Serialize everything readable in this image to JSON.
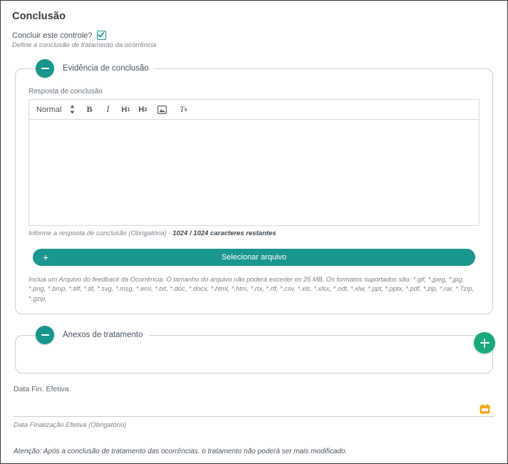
{
  "page": {
    "title": "Conclusão"
  },
  "conclude_control": {
    "label": "Concluir este controle?",
    "checked": true,
    "hint": "Define a conclusão de tratamento da ocorrência"
  },
  "evidence_group": {
    "legend": "Evidência de conclusão",
    "collapse_icon": "minus-icon",
    "answer_label": "Resposta de conclusão",
    "toolbar": {
      "format_select": "Normal",
      "caret_icon": "updown-caret-icon",
      "bold": "B",
      "italic": "I",
      "h1": "H1",
      "h1_main": "H",
      "h1_sub": "1",
      "h2_main": "H",
      "h2_sub": "2",
      "image_icon": "image-icon",
      "clear_main": "T",
      "clear_sub": "x"
    },
    "editor_value": "",
    "char_hint_prefix": "Informe a resposta de conclusão (Obrigatória) - ",
    "char_hint_counter": "1024 / 1024 caracteres restantes",
    "file_button": {
      "label": "Selecionar arquivo",
      "plus_icon": "plus-icon"
    },
    "formats_hint": "Inclua um Arquivo do feedback da Ocorrência. O tamanho do arquivo não poderá exceder os 25 MB. Os formatos suportados são: *.gif, *.jpeg, *.jpg, *.png, *.bmp, *.tiff, *.tif, *.svg, *.msg, *.eml, *.txt, *.doc, *.docx, *.html, *.htm, *.rtx, *.rtf, *.csv, *.xls, *.xlsx, *.odt, *.xlw, *.ppt, *.pptx, *.pdf, *.zip, *.rar, *.7zip, *.gzip."
  },
  "attachments_group": {
    "legend": "Anexos de tratamento",
    "collapse_icon": "minus-icon",
    "add_icon": "plus-icon"
  },
  "date_field": {
    "label": "Data Fin. Efetiva",
    "value": "",
    "calendar_icon": "calendar-icon",
    "hint": "Data Finalização Efetiva (Obrigatório)"
  },
  "footer": {
    "warning": "Atenção: Após a conclusão de tratamento das ocorrências, o tratamento não poderá ser mais modificado."
  },
  "colors": {
    "teal": "#1a978e",
    "green": "#19a97c",
    "amber": "#f4a81d"
  }
}
